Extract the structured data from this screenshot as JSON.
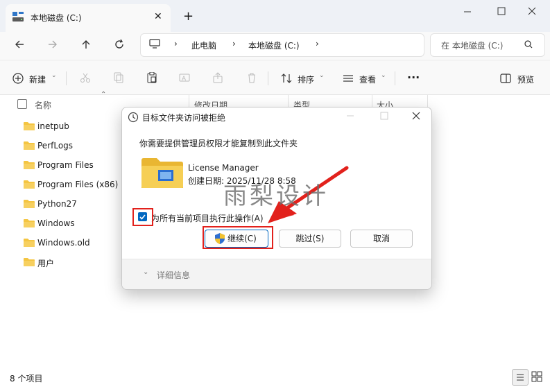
{
  "window": {
    "tab_title": "本地磁盘 (C:)",
    "new_tab_symbol": "+"
  },
  "address": {
    "crumbs": [
      "此电脑",
      "本地磁盘 (C:)"
    ],
    "search_placeholder": "在 本地磁盘 (C:)"
  },
  "toolbar": {
    "new_label": "新建",
    "sort_label": "排序",
    "view_label": "查看",
    "more_label": "···",
    "preview_label": "预览"
  },
  "columns": {
    "name": "名称",
    "date": "修改日期",
    "type": "类型",
    "size": "大小"
  },
  "files": [
    {
      "name": "inetpub"
    },
    {
      "name": "PerfLogs"
    },
    {
      "name": "Program Files"
    },
    {
      "name": "Program Files (x86)"
    },
    {
      "name": "Python27"
    },
    {
      "name": "Windows"
    },
    {
      "name": "Windows.old"
    },
    {
      "name": "用户"
    }
  ],
  "status": {
    "count": "8 个项目"
  },
  "dialog": {
    "title": "目标文件夹访问被拒绝",
    "message": "你需要提供管理员权限才能复制到此文件夹",
    "item_name": "License Manager",
    "item_created": "创建日期: 2025/11/28 8:58",
    "checkbox_label": "为所有当前项目执行此操作(A)",
    "continue_label": "继续(C)",
    "skip_label": "跳过(S)",
    "cancel_label": "取消",
    "details_label": "详细信息"
  },
  "watermark": "雨梨设计",
  "colors": {
    "accent": "#0067c0",
    "annotation_red": "#e2211c",
    "folder_yellow": "#f4c542"
  }
}
